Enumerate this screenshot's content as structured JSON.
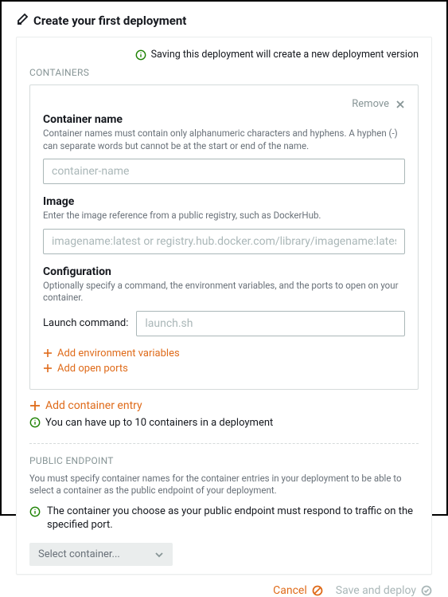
{
  "header": {
    "title": "Create your first deployment"
  },
  "info_banner": "Saving this deployment will create a new deployment version",
  "containers_section": {
    "label": "CONTAINERS",
    "box": {
      "remove_label": "Remove",
      "name_field": {
        "title": "Container name",
        "desc": "Container names must contain only alphanumeric characters and hyphens. A hyphen (-) can separate words but cannot be at the start or end of the name.",
        "placeholder": "container-name",
        "value": ""
      },
      "image_field": {
        "title": "Image",
        "desc": "Enter the image reference from a public registry, such as DockerHub.",
        "placeholder": "imagename:latest or registry.hub.docker.com/library/imagename:latest",
        "value": ""
      },
      "config_field": {
        "title": "Configuration",
        "desc": "Optionally specify a command, the environment variables, and the ports to open on your container.",
        "launch_label": "Launch command:",
        "launch_placeholder": "launch.sh",
        "launch_value": "",
        "add_env": "Add environment variables",
        "add_ports": "Add open ports"
      }
    },
    "add_entry": "Add container entry",
    "limit_note": "You can have up to 10 containers in a deployment"
  },
  "endpoint_section": {
    "label": "PUBLIC ENDPOINT",
    "desc": "You must specify container names for the container entries in your deployment to be able to select a container as the public endpoint of your deployment.",
    "note": "The container you choose as your public endpoint must respond to traffic on the specified port.",
    "select_placeholder": "Select container..."
  },
  "footer": {
    "cancel": "Cancel",
    "save": "Save and deploy"
  }
}
